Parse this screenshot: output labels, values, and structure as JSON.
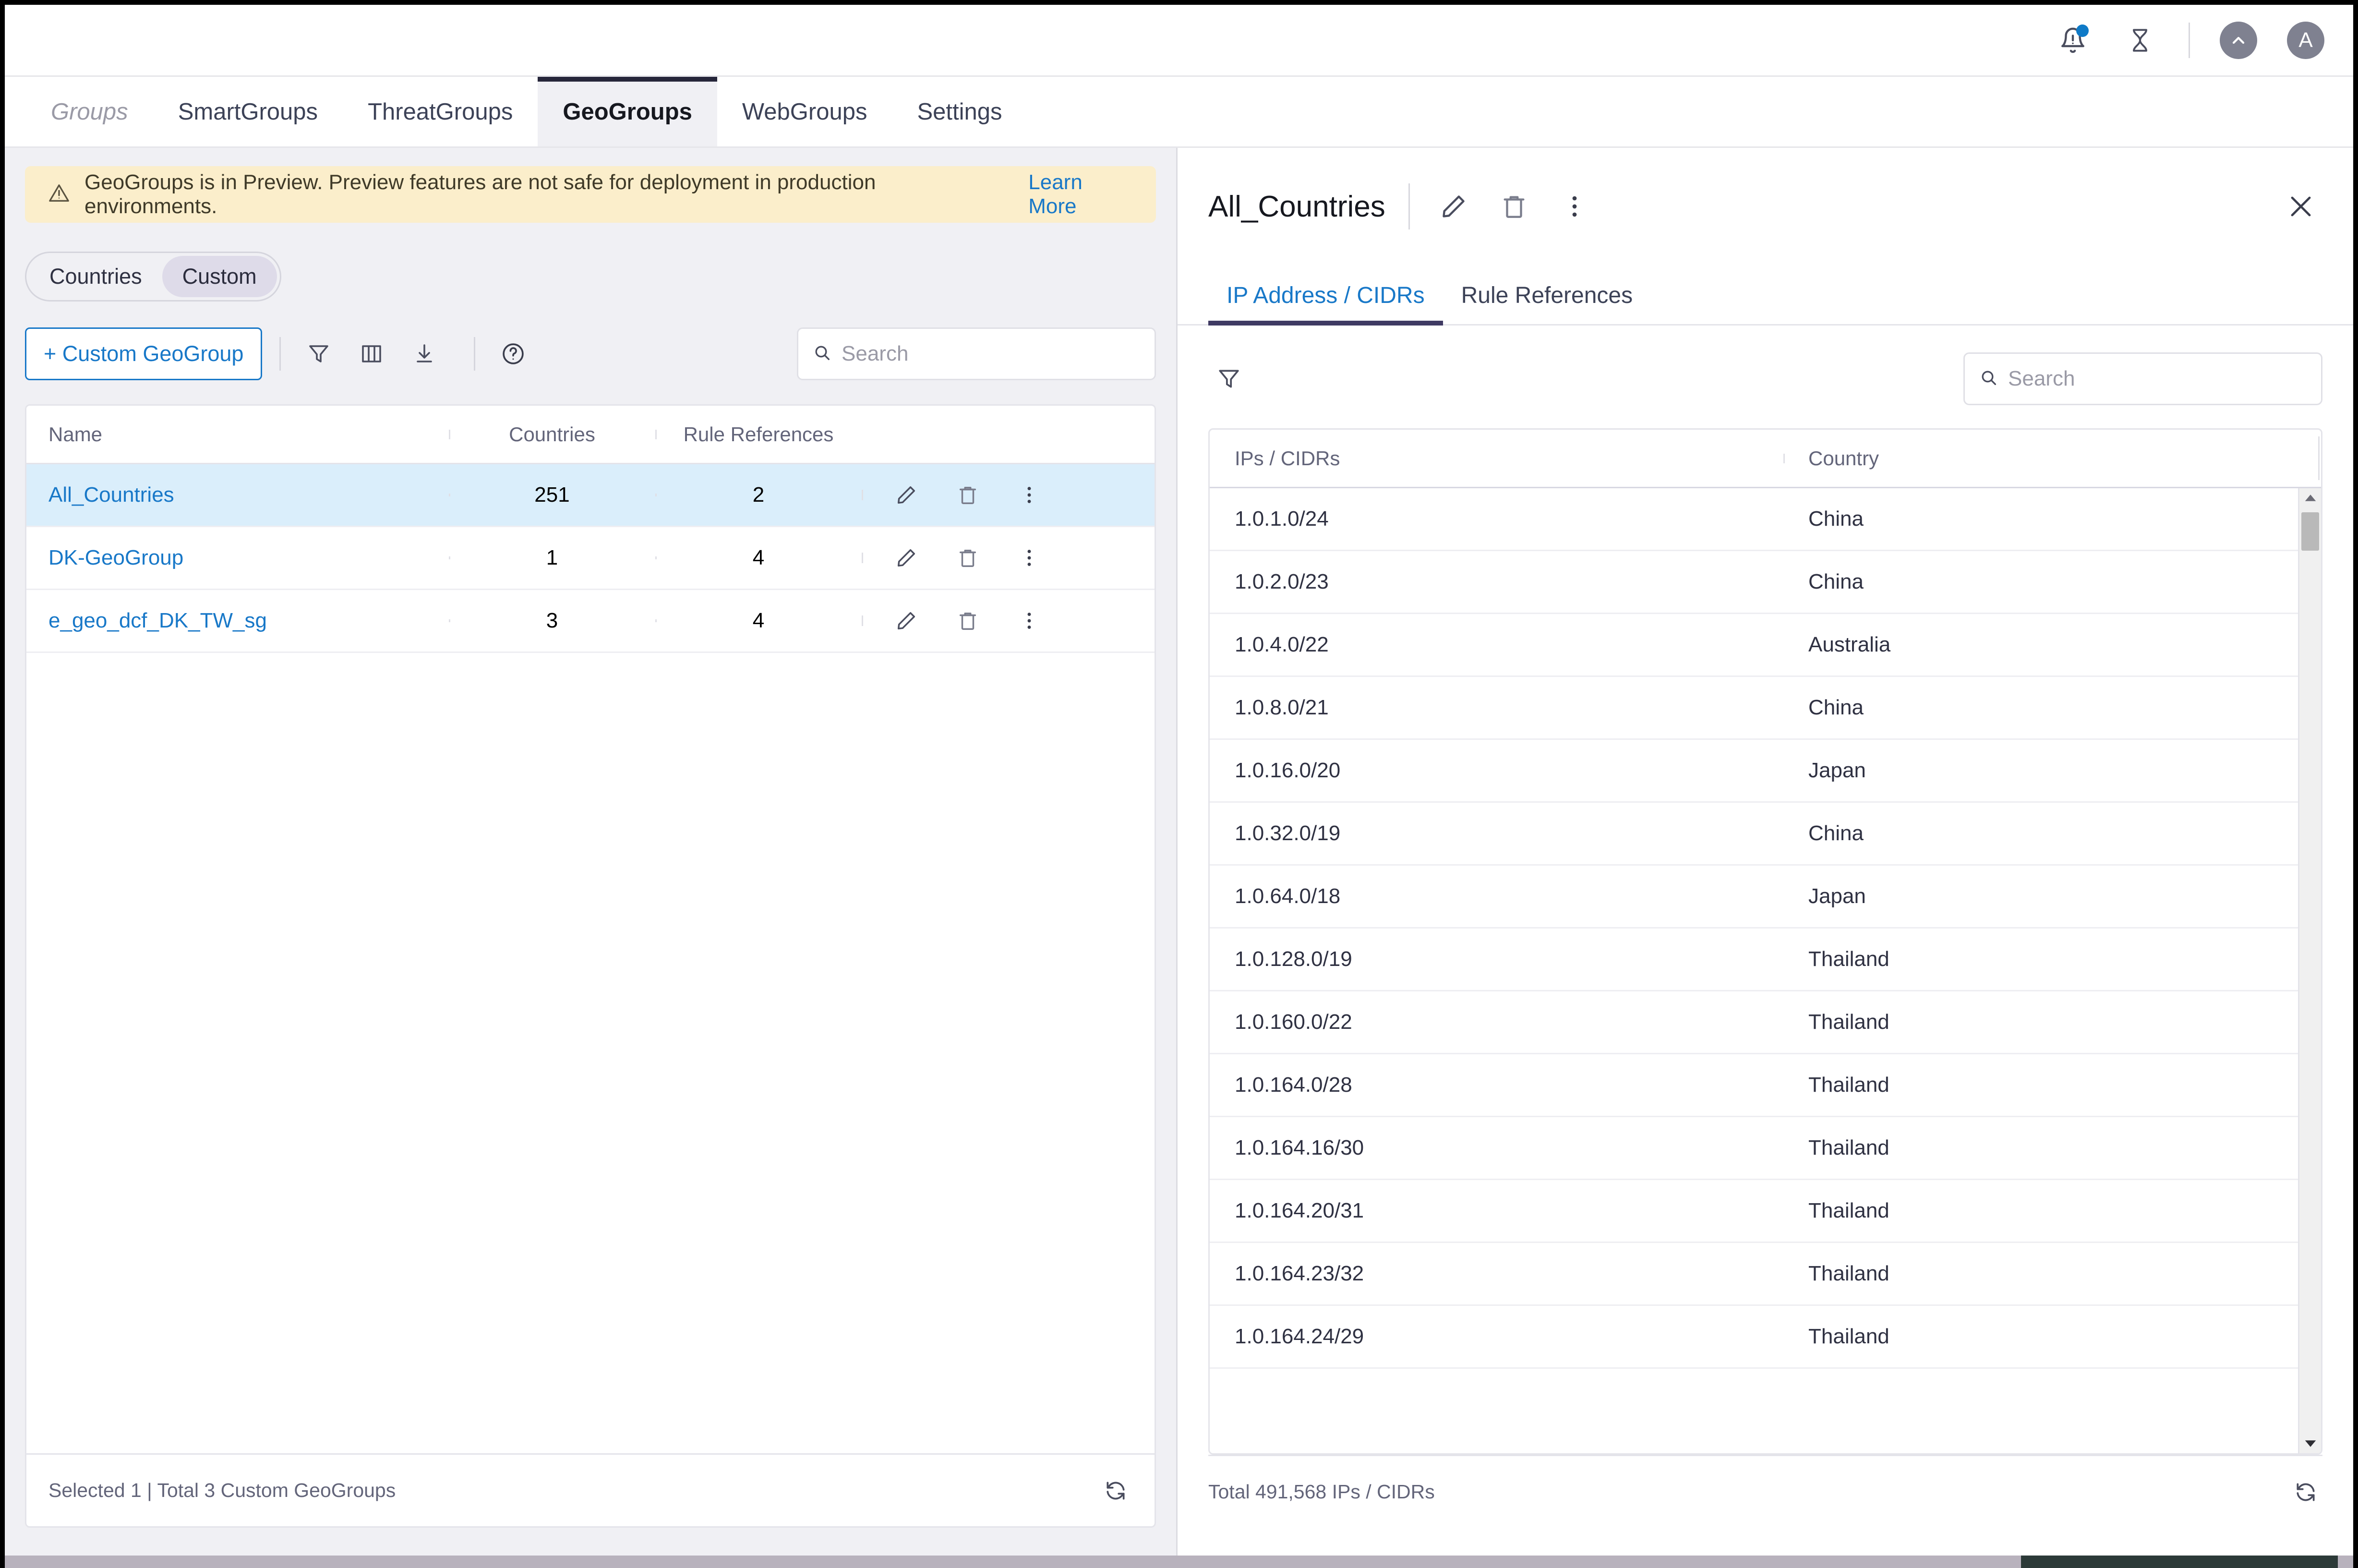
{
  "topbar": {
    "notifications_icon": "bell-icon",
    "has_notification_badge": true,
    "pending_icon": "hourglass-icon",
    "up_avatar_letter": "^",
    "user_avatar_letter": "A"
  },
  "nav": {
    "tabs": [
      {
        "label": "Groups",
        "active": false,
        "muted": true
      },
      {
        "label": "SmartGroups",
        "active": false,
        "muted": false
      },
      {
        "label": "ThreatGroups",
        "active": false,
        "muted": false
      },
      {
        "label": "GeoGroups",
        "active": true,
        "muted": false
      },
      {
        "label": "WebGroups",
        "active": false,
        "muted": false
      },
      {
        "label": "Settings",
        "active": false,
        "muted": false
      }
    ]
  },
  "left": {
    "banner": {
      "icon": "warning-triangle-icon",
      "text": "GeoGroups is in Preview. Preview features are not safe for deployment in production environments.",
      "link_label": "Learn More"
    },
    "segmented": {
      "options": [
        {
          "label": "Countries",
          "active": false
        },
        {
          "label": "Custom",
          "active": true
        }
      ]
    },
    "toolbar": {
      "create_label": "+ Custom GeoGroup",
      "filter_icon": "filter-icon",
      "columns_icon": "columns-icon",
      "download_icon": "download-icon",
      "help_icon": "help-circle-icon"
    },
    "search": {
      "value": "",
      "placeholder": "Search",
      "icon": "search-icon"
    },
    "table": {
      "columns": [
        "Name",
        "Countries",
        "Rule References"
      ],
      "rows": [
        {
          "name": "All_Countries",
          "countries": "251",
          "rule_references": "2",
          "selected": true
        },
        {
          "name": "DK-GeoGroup",
          "countries": "1",
          "rule_references": "4",
          "selected": false
        },
        {
          "name": "e_geo_dcf_DK_TW_sg",
          "countries": "3",
          "rule_references": "4",
          "selected": false
        }
      ],
      "row_actions": {
        "edit_icon": "pencil-icon",
        "delete_icon": "trash-icon",
        "more_icon": "more-vertical-icon"
      }
    },
    "footer": {
      "status": "Selected 1 | Total 3 Custom GeoGroups",
      "refresh_icon": "refresh-icon"
    }
  },
  "right": {
    "title": "All_Countries",
    "header_actions": {
      "edit_icon": "pencil-icon",
      "delete_icon": "trash-icon",
      "more_icon": "more-vertical-icon",
      "close_icon": "close-icon"
    },
    "tabs": [
      {
        "label": "IP Address / CIDRs",
        "active": true
      },
      {
        "label": "Rule References",
        "active": false
      }
    ],
    "tools": {
      "filter_icon": "filter-icon"
    },
    "search": {
      "value": "",
      "placeholder": "Search",
      "icon": "search-icon"
    },
    "table": {
      "columns": [
        "IPs / CIDRs",
        "Country"
      ],
      "rows": [
        {
          "ip": "1.0.1.0/24",
          "country": "China"
        },
        {
          "ip": "1.0.2.0/23",
          "country": "China"
        },
        {
          "ip": "1.0.4.0/22",
          "country": "Australia"
        },
        {
          "ip": "1.0.8.0/21",
          "country": "China"
        },
        {
          "ip": "1.0.16.0/20",
          "country": "Japan"
        },
        {
          "ip": "1.0.32.0/19",
          "country": "China"
        },
        {
          "ip": "1.0.64.0/18",
          "country": "Japan"
        },
        {
          "ip": "1.0.128.0/19",
          "country": "Thailand"
        },
        {
          "ip": "1.0.160.0/22",
          "country": "Thailand"
        },
        {
          "ip": "1.0.164.0/28",
          "country": "Thailand"
        },
        {
          "ip": "1.0.164.16/30",
          "country": "Thailand"
        },
        {
          "ip": "1.0.164.20/31",
          "country": "Thailand"
        },
        {
          "ip": "1.0.164.23/32",
          "country": "Thailand"
        },
        {
          "ip": "1.0.164.24/29",
          "country": "Thailand"
        }
      ]
    },
    "footer": {
      "status": "Total 491,568 IPs / CIDRs",
      "refresh_icon": "refresh-icon"
    }
  },
  "colors": {
    "accent_blue": "#1878c8",
    "selected_row": "#daeefb",
    "banner_bg": "#fbeecb",
    "pane_bg": "#f0f0f4",
    "active_tab_underline": "#3f3a63"
  }
}
